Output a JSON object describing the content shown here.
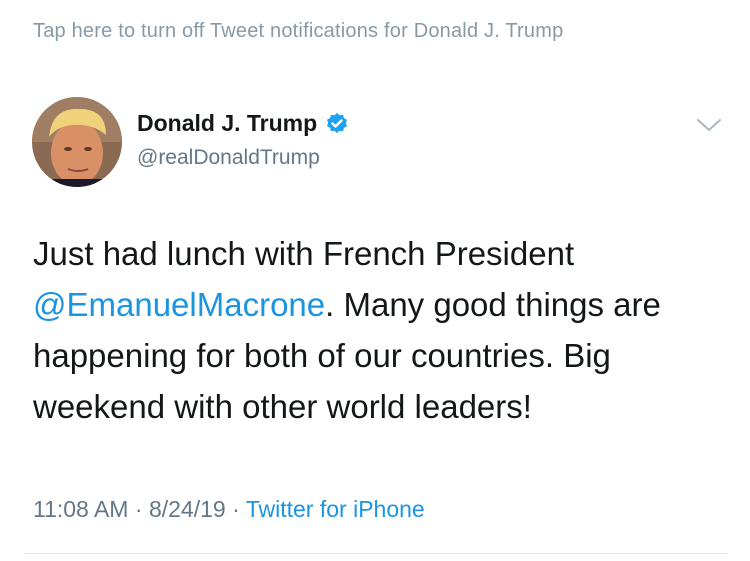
{
  "notification_banner": "Tap here to turn off Tweet notifications for Donald J. Trump",
  "author": {
    "name": "Donald J. Trump",
    "handle": "@realDonaldTrump",
    "verified": true
  },
  "tweet": {
    "text_before": "Just had lunch with French President ",
    "mention": "@EmanuelMacrone",
    "text_after": ". Many good things are happening for both of our countries. Big weekend with other world leaders!"
  },
  "meta": {
    "time": "11:08 AM",
    "separator": "·",
    "date": "8/24/19",
    "source": "Twitter for iPhone"
  },
  "colors": {
    "link": "#1b95e0",
    "secondary_text": "#657786",
    "primary_text": "#14171a",
    "verified_badge": "#1da1f2"
  },
  "icons": {
    "verified": "verified-badge-icon",
    "more": "chevron-down-icon"
  }
}
